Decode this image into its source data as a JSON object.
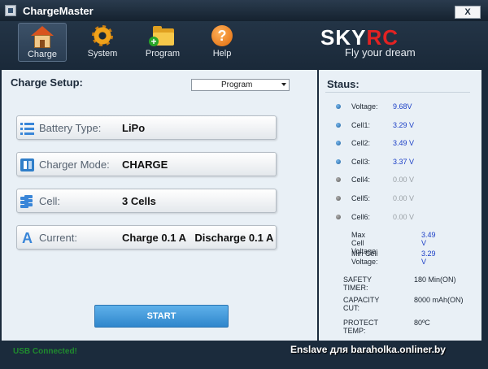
{
  "window": {
    "title": "ChargeMaster",
    "close_label": "X"
  },
  "toolbar": {
    "items": [
      {
        "label": "Charge",
        "icon": "house-icon",
        "active": true
      },
      {
        "label": "System",
        "icon": "gear-icon",
        "active": false
      },
      {
        "label": "Program",
        "icon": "folder-add-icon",
        "active": false
      },
      {
        "label": "Help",
        "icon": "help-icon",
        "active": false
      }
    ]
  },
  "logo": {
    "brand_sky": "SKY",
    "brand_rc": "RC",
    "tagline": "Fly your dream"
  },
  "setup": {
    "title": "Charge Setup:",
    "program_select": "Program",
    "fields": [
      {
        "label": "Battery Type:",
        "value": "LiPo",
        "icon": "list-icon"
      },
      {
        "label": "Charger Mode:",
        "value": "CHARGE",
        "icon": "battery-icon"
      },
      {
        "label": "Cell:",
        "value": "3 Cells",
        "icon": "cells-icon"
      },
      {
        "label": "Current:",
        "value": "Charge 0.1 A   Discharge 0.1 A",
        "icon": "ampere-icon"
      }
    ],
    "start_label": "START"
  },
  "status": {
    "title": "Staus:",
    "readings": [
      {
        "label": "Voltage:",
        "value": "9.68V",
        "active": true
      },
      {
        "label": "Cell1:",
        "value": "3.29 V",
        "active": true
      },
      {
        "label": "Cell2:",
        "value": "3.49 V",
        "active": true
      },
      {
        "label": "Cell3:",
        "value": "3.37 V",
        "active": true
      },
      {
        "label": "Cell4:",
        "value": "0.00 V",
        "active": false
      },
      {
        "label": "Cell5:",
        "value": "0.00 V",
        "active": false
      },
      {
        "label": "Cell6:",
        "value": "0.00 V",
        "active": false
      }
    ],
    "max_cell": {
      "label": "Max Cell Voltage:",
      "value": "3.49 V"
    },
    "min_cell": {
      "label": "Min Cell Voltage:",
      "value": "3.29 V"
    },
    "safety_timer": {
      "label": "SAFETY TIMER:",
      "value": "180 Min(ON)"
    },
    "capacity_cut": {
      "label": "CAPACITY CUT:",
      "value": "8000 mAh(ON)"
    },
    "protect_temp": {
      "label": "PROTECT TEMP:",
      "value": "80ºC"
    }
  },
  "footer": {
    "usb_status": "USB  Connected!",
    "watermark": "Enslave для baraholka.onliner.by"
  },
  "colors": {
    "frame": "#1b2b3c",
    "panel": "#e9f0f6",
    "accent_blue": "#2f86cc",
    "value_blue": "#1a3ec6",
    "usb_green": "#1f8a2e",
    "logo_red": "#e22222"
  }
}
